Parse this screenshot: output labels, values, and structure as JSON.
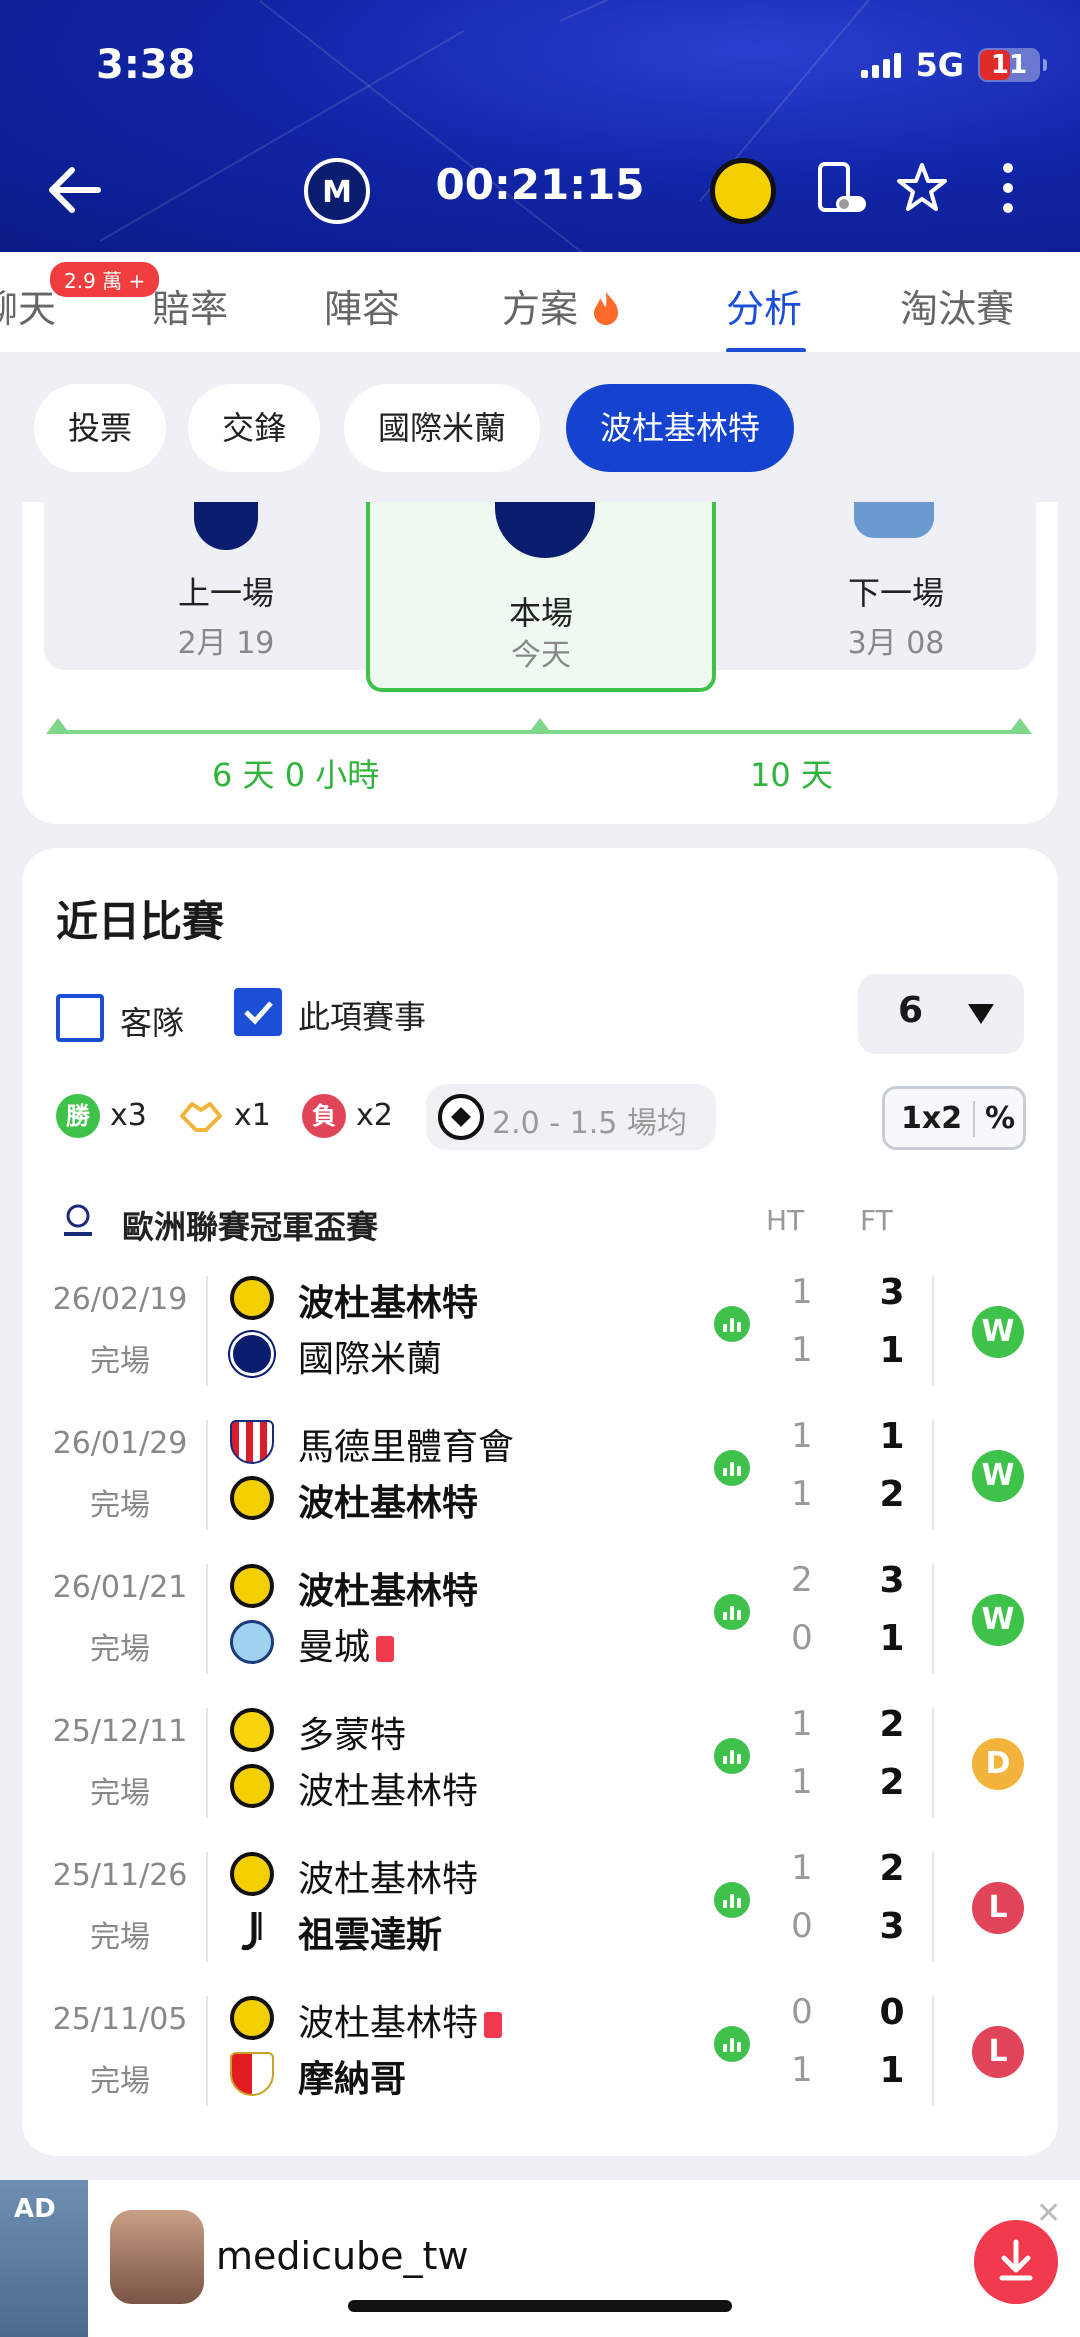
{
  "status_bar": {
    "time": "3:38",
    "network": "5G",
    "battery": "11"
  },
  "header": {
    "match_clock": "00:21:15"
  },
  "tabs": [
    {
      "label": "聊天",
      "badge": "2.9 萬 +"
    },
    {
      "label": "賠率"
    },
    {
      "label": "陣容"
    },
    {
      "label": "方案"
    },
    {
      "label": "分析",
      "active": true
    },
    {
      "label": "淘汰賽"
    }
  ],
  "subtabs": [
    "投票",
    "交鋒",
    "國際米蘭",
    "波杜基林特"
  ],
  "fixture": {
    "prev": {
      "label": "上一場",
      "date": "2月 19"
    },
    "current": {
      "label": "本場",
      "date": "今天"
    },
    "next": {
      "label": "下一場",
      "date": "3月 08"
    },
    "gap_before": "6 天 0 小時",
    "gap_after": "10 天"
  },
  "recent": {
    "title": "近日比賽",
    "filter_away": "客隊",
    "filter_competition": "此項賽事",
    "count": "6",
    "stats": {
      "win_label": "勝",
      "win": "x3",
      "draw": "x1",
      "loss_label": "負",
      "loss": "x2"
    },
    "avg": "2.0 - 1.5 場均",
    "toggle_a": "1x2",
    "toggle_b": "%",
    "league": "歐洲聯賽冠軍盃賽",
    "col_ht": "HT",
    "col_ft": "FT",
    "matches": [
      {
        "date": "26/02/19",
        "status": "完場",
        "home": "波杜基林特",
        "away": "國際米蘭",
        "ht_home": "1",
        "ht_away": "1",
        "ft_home": "3",
        "ft_away": "1",
        "result": "W"
      },
      {
        "date": "26/01/29",
        "status": "完場",
        "home": "馬德里體育會",
        "away": "波杜基林特",
        "ht_home": "1",
        "ht_away": "1",
        "ft_home": "1",
        "ft_away": "2",
        "result": "W"
      },
      {
        "date": "26/01/21",
        "status": "完場",
        "home": "波杜基林特",
        "away": "曼城",
        "ht_home": "2",
        "ht_away": "0",
        "ft_home": "3",
        "ft_away": "1",
        "result": "W"
      },
      {
        "date": "25/12/11",
        "status": "完場",
        "home": "多蒙特",
        "away": "波杜基林特",
        "ht_home": "1",
        "ht_away": "1",
        "ft_home": "2",
        "ft_away": "2",
        "result": "D"
      },
      {
        "date": "25/11/26",
        "status": "完場",
        "home": "波杜基林特",
        "away": "祖雲達斯",
        "ht_home": "1",
        "ht_away": "0",
        "ft_home": "2",
        "ft_away": "3",
        "result": "L"
      },
      {
        "date": "25/11/05",
        "status": "完場",
        "home": "波杜基林特",
        "away": "摩納哥",
        "ht_home": "0",
        "ht_away": "1",
        "ft_home": "0",
        "ft_away": "1",
        "result": "L"
      }
    ]
  },
  "ad": {
    "tag": "AD",
    "name": "medicube_tw"
  },
  "colors": {
    "accent": "#1a4fd6",
    "win": "#3ec24a",
    "draw": "#f2b43c",
    "loss": "#e0455a"
  }
}
